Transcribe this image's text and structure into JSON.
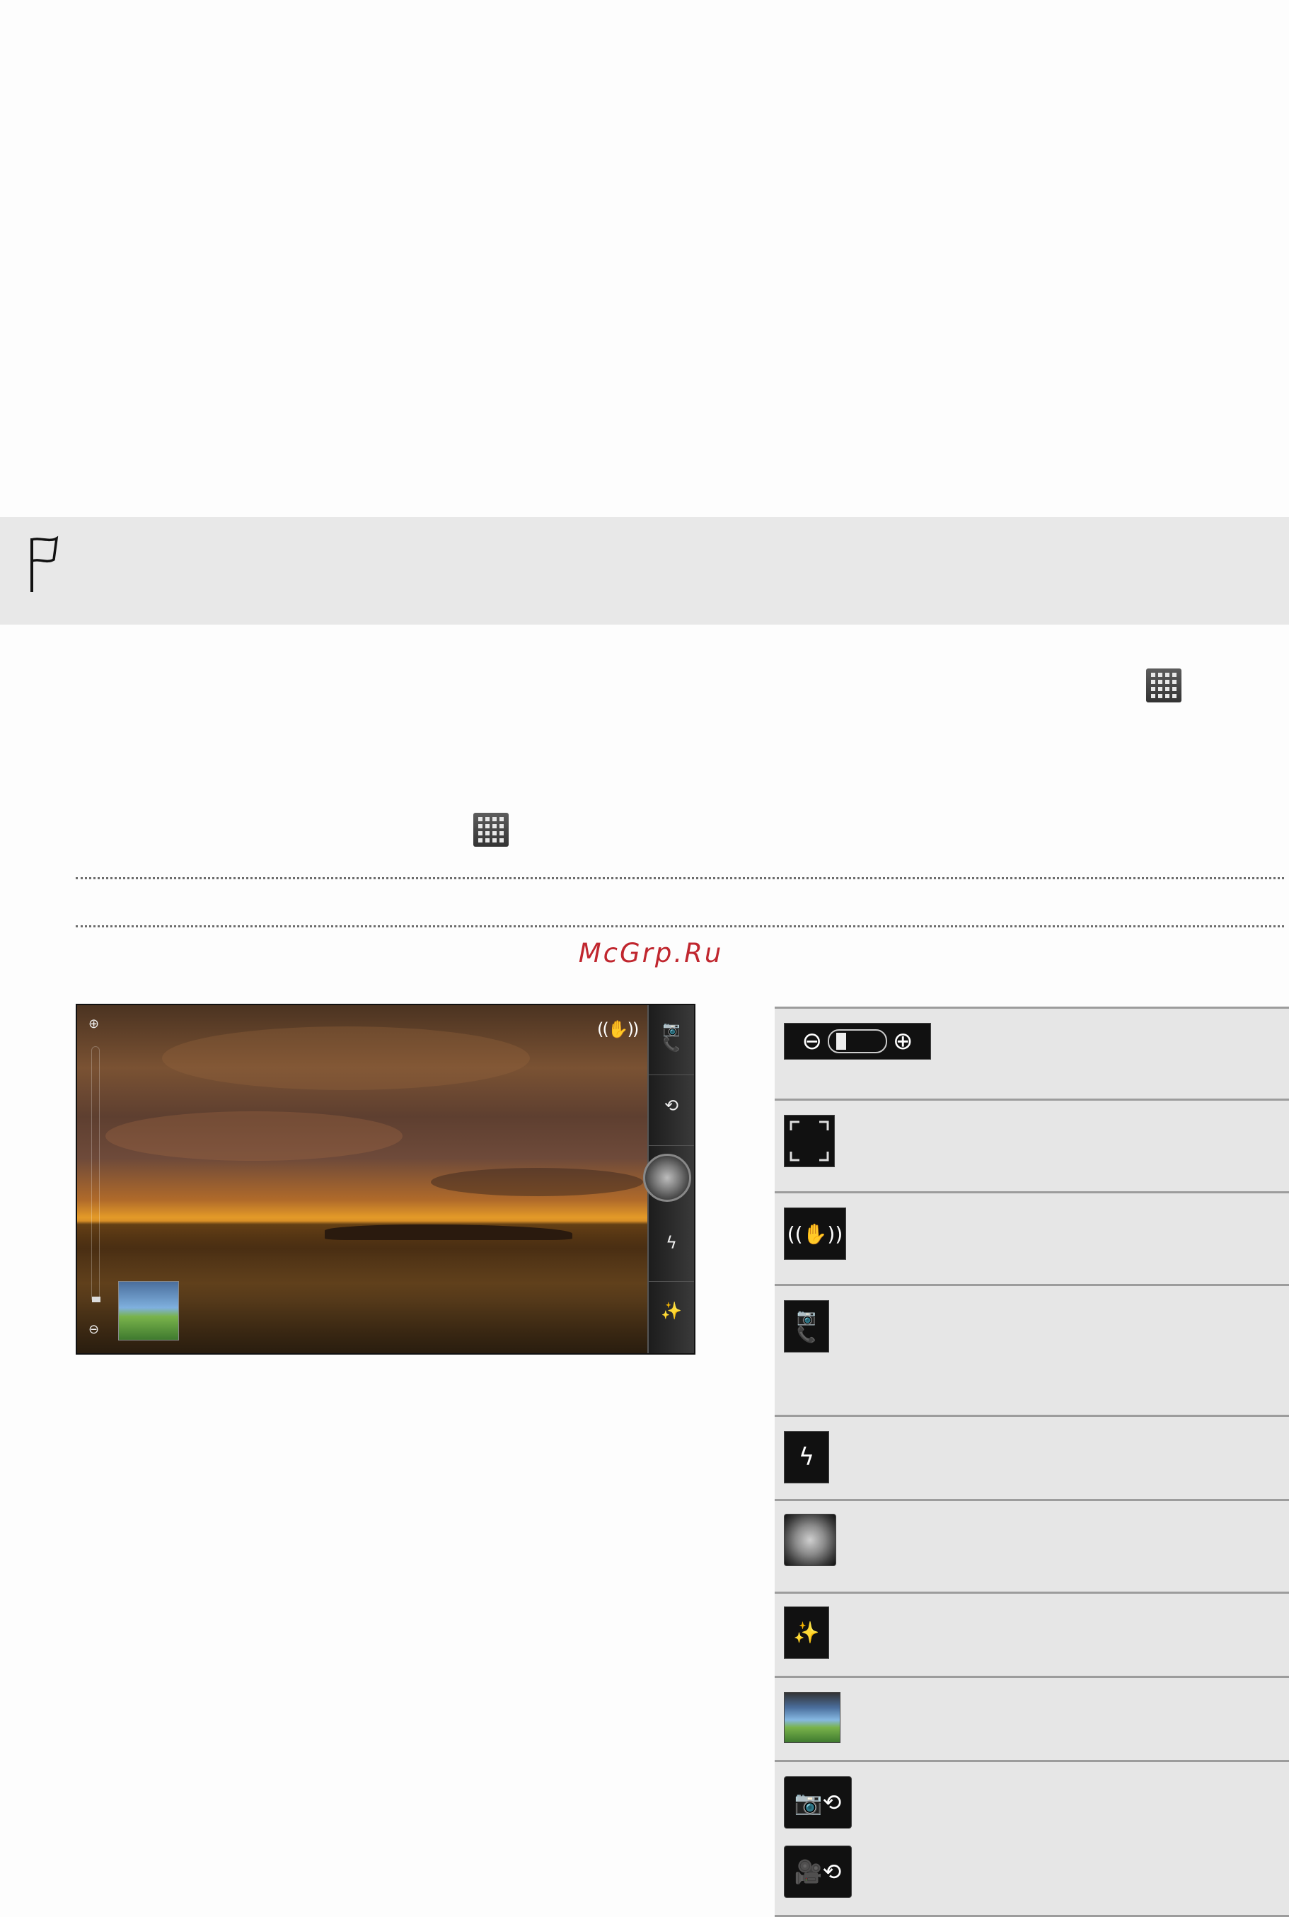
{
  "watermark": "McGrp.Ru",
  "camera_screen": {
    "zoom_in_icon": "zoom-in-icon",
    "zoom_out_icon": "zoom-out-icon",
    "zoom_level": 0.02,
    "stabilizer_icon": "hand-shake-icon",
    "sidebar_icons": [
      "camera-video-switch-icon",
      "front-rear-camera-switch-icon",
      "shutter-icon",
      "flash-auto-icon",
      "effects-icon"
    ],
    "thumbnail_icon": "gallery-thumbnail-icon"
  },
  "legend": {
    "rows": [
      {
        "icon": "zoom-bar-icon"
      },
      {
        "icon": "focus-frame-icon"
      },
      {
        "icon": "image-stabilizer-icon"
      },
      {
        "icon": "camera-video-switch-icon"
      },
      {
        "icon": "flash-auto-icon"
      },
      {
        "icon": "shutter-icon"
      },
      {
        "icon": "effects-icon"
      },
      {
        "icon": "gallery-icon"
      },
      {
        "icon": "front-rear-camera-switch-icon"
      }
    ]
  }
}
